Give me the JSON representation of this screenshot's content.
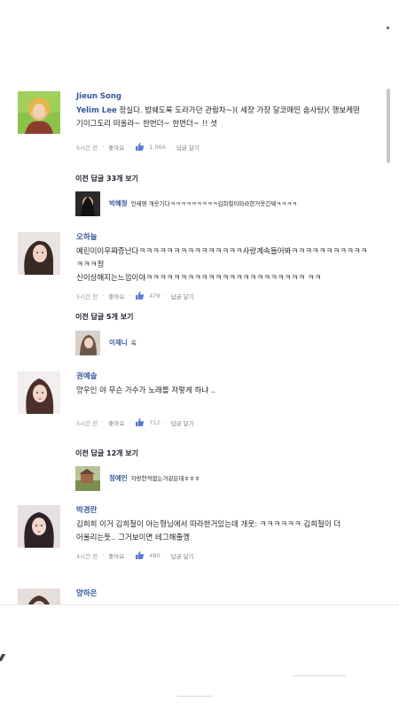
{
  "comments": [
    {
      "name": "Jieun Song",
      "tag": "Yelim Lee",
      "text": " 정실다. 밤쉐도록 도라가던 관람차~)( 세쟝 가장 달코매띤 솜사탕)( 행보케떤\n기이그도리 떠올라~ 한번더~ 한번더~ !! 셧",
      "time": "5시간 전",
      "like_label": "좋아요",
      "likes": "1,069",
      "reply_label": "답글 달기"
    },
    {
      "name": "오하늘",
      "text": "예린이이우쨔증난다ㅋㅋㅋㅋㅋㅋㅋㅋㅋㅋㅋㅋㅋㅋㅋ사랑계속들어봐ㅋㅋㅋㅋㅋㅋㅋㅋㅋㅋㅋㅋㅋㅋ정\n신이상해지는느낌이야ㅋㅋㅋㅋㅋㅋㅋㅋㅋㅋㅋㅋㅋㅋㅋㅋㅋㅋㅋㅋㅋㅋㅋ      ㅋㅋ",
      "time": "5시간 전",
      "like_label": "좋아요",
      "likes": "479",
      "reply_label": "답글 달기"
    },
    {
      "name": "권예슬",
      "text": "양우인 야 무슨 가수가 노래를 저렇게 하냐 ..",
      "time": "5시간 전",
      "like_label": "좋아요",
      "likes": "712",
      "reply_label": "답글 달기"
    },
    {
      "name": "박경란",
      "text": "김희희 이거 김희철이 아는형님에서 따라한거있는데 개웃:        ㅋㅋㅋㅋㅋㅋ 김희철이 더\n어울리는듯.. 그거보이면 테그해줄껭",
      "time": "4시간 전",
      "like_label": "좋아요",
      "likes": "480",
      "reply_label": "답글 달기"
    },
    {
      "name": "양하은"
    }
  ],
  "more_replies": [
    {
      "label": "이전 답글 33개 보기",
      "reply_name": "박혜정",
      "reply_text": "인세영 개웃기다ㅋㅋㅋㅋㅋㅋㅋㅋㅋ김희철이따라한거웃긴뎈ㅋㅋㅋㅋ"
    },
    {
      "label": "이전 답글 5개 보기",
      "reply_name": "이재니",
      "reply_text": "옥"
    },
    {
      "label": "이전 답글 12개 보기",
      "reply_name": "정예인",
      "reply_text": "자랑한적없는거같은데ㅎㅎㅎ"
    }
  ],
  "colors": {
    "name_blue": "#365899",
    "like_blue": "#5b7bd5",
    "meta_gray": "#90949c"
  }
}
